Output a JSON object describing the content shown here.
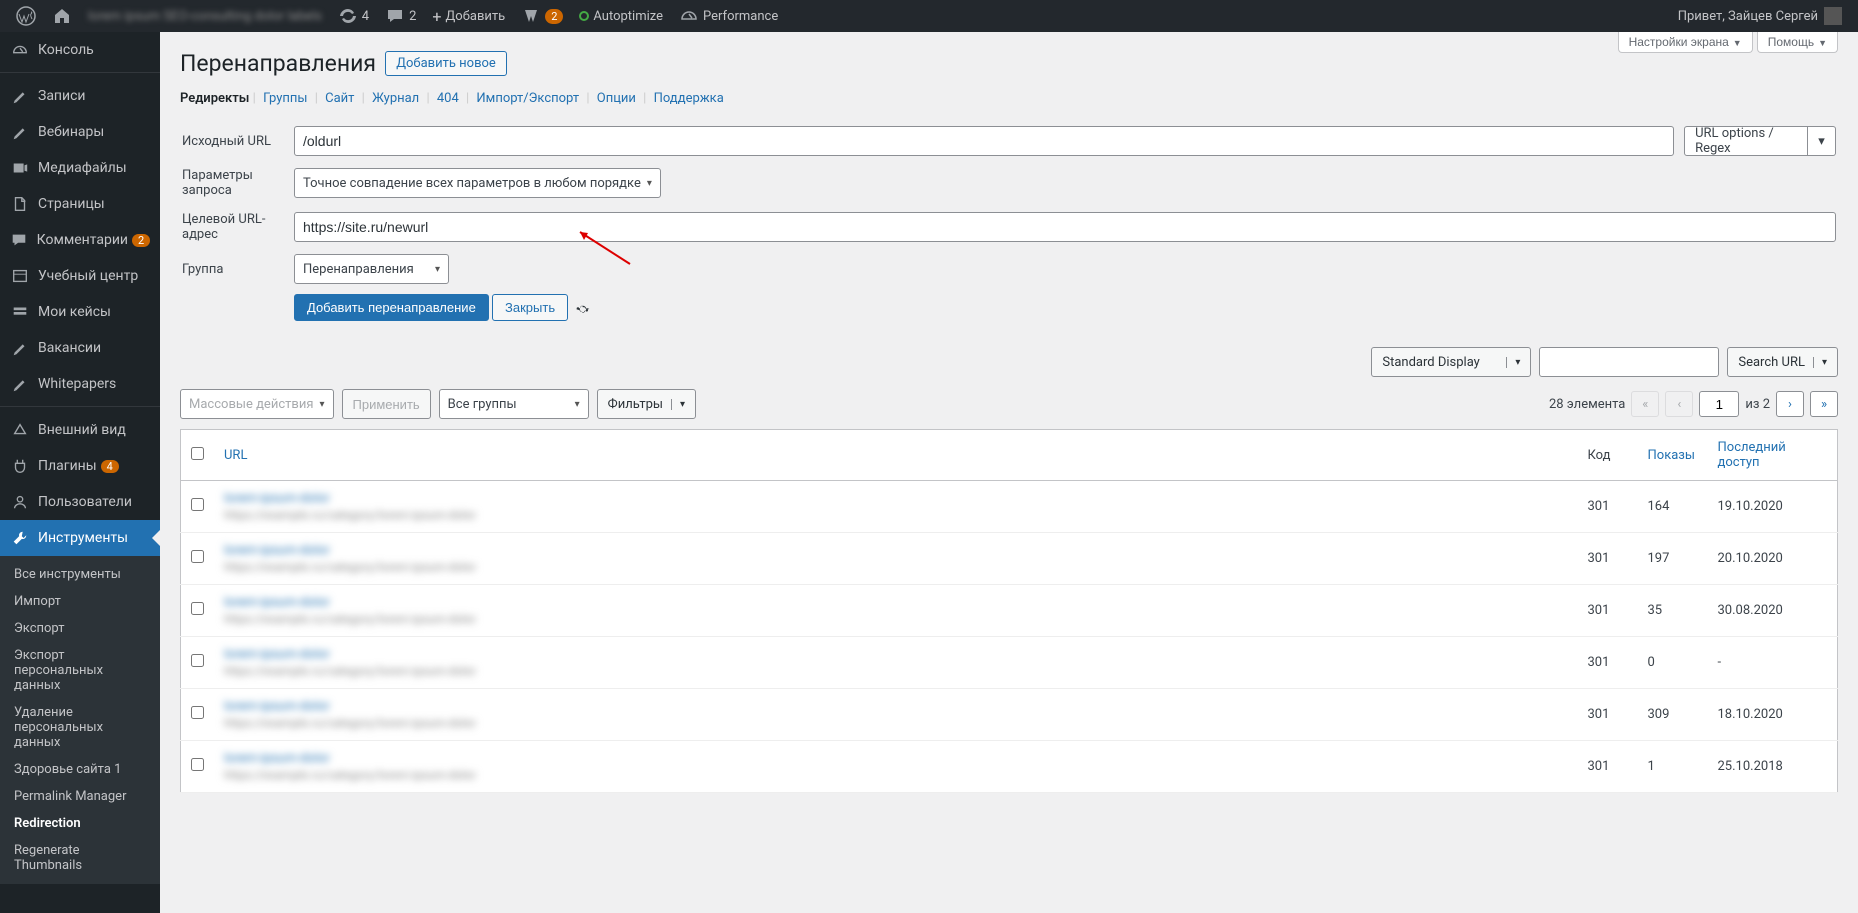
{
  "adminbar": {
    "site_name_blur": "lorem ipsum SEO-consulting dolor labels",
    "updates": "4",
    "comments": "2",
    "add": "Добавить",
    "yoast_badge": "2",
    "autoptimize": "Autoptimize",
    "performance": "Performance",
    "greeting": "Привет, Зайцев Сергей"
  },
  "sidebar": {
    "items": [
      {
        "label": "Консоль"
      },
      {
        "label": "Записи"
      },
      {
        "label": "Вебинары"
      },
      {
        "label": "Медиафайлы"
      },
      {
        "label": "Страницы"
      },
      {
        "label": "Комментарии",
        "badge": "2"
      },
      {
        "label": "Учебный центр"
      },
      {
        "label": "Мои кейсы"
      },
      {
        "label": "Вакансии"
      },
      {
        "label": "Whitepapers"
      },
      {
        "label": "Внешний вид"
      },
      {
        "label": "Плагины",
        "badge": "4"
      },
      {
        "label": "Пользователи"
      },
      {
        "label": "Инструменты"
      }
    ],
    "submenu": [
      "Все инструменты",
      "Импорт",
      "Экспорт",
      "Экспорт персональных данных",
      "Удаление персональных данных",
      "Здоровье сайта",
      "Permalink Manager",
      "Redirection",
      "Regenerate Thumbnails"
    ],
    "health_badge": "1"
  },
  "screen_meta": {
    "options": "Настройки экрана",
    "help": "Помощь"
  },
  "page": {
    "title": "Перенаправления",
    "add_new": "Добавить новое",
    "tabs": [
      "Редиректы",
      "Группы",
      "Сайт",
      "Журнал",
      "404",
      "Импорт/Экспорт",
      "Опции",
      "Поддержка"
    ]
  },
  "form": {
    "source_label": "Исходный URL",
    "source_value": "/oldurl",
    "url_options": "URL options / Regex",
    "query_label": "Параметры запроса",
    "query_value": "Точное совпадение всех параметров в любом порядке",
    "target_label": "Целевой URL-адрес",
    "target_value": "https://site.ru/newurl",
    "group_label": "Группа",
    "group_value": "Перенаправления",
    "add_btn": "Добавить перенаправление",
    "close_btn": "Закрыть"
  },
  "toolbar": {
    "display": "Standard Display",
    "search": "Search URL",
    "bulk": "Массовые действия",
    "apply": "Применить",
    "all_groups": "Все группы",
    "filters": "Фильтры",
    "count": "28 элемента",
    "of": "из 2",
    "page": "1"
  },
  "table": {
    "headers": {
      "url": "URL",
      "code": "Код",
      "hits": "Показы",
      "last": "Последний доступ"
    },
    "rows": [
      {
        "code": "301",
        "hits": "164",
        "date": "19.10.2020"
      },
      {
        "code": "301",
        "hits": "197",
        "date": "20.10.2020"
      },
      {
        "code": "301",
        "hits": "35",
        "date": "30.08.2020"
      },
      {
        "code": "301",
        "hits": "0",
        "date": "-"
      },
      {
        "code": "301",
        "hits": "309",
        "date": "18.10.2020"
      },
      {
        "code": "301",
        "hits": "1",
        "date": "25.10.2018"
      }
    ]
  }
}
